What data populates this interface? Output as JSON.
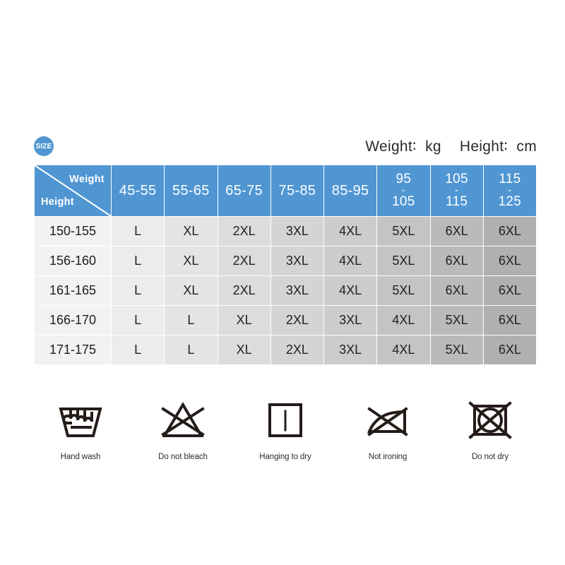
{
  "badge": {
    "label": "SIZE",
    "ghost_text": ""
  },
  "units": {
    "weight": "Weight∶  kg",
    "height": "Height∶  cm"
  },
  "table": {
    "corner": {
      "weight_label": "Weight",
      "height_label": "Height"
    },
    "weight_columns": [
      {
        "text": "45-55",
        "stacked": false
      },
      {
        "text": "55-65",
        "stacked": false
      },
      {
        "text": "65-75",
        "stacked": false
      },
      {
        "text": "75-85",
        "stacked": false
      },
      {
        "text": "85-95",
        "stacked": false
      },
      {
        "text": "95-105",
        "stacked": true,
        "top": "95",
        "dash": "-",
        "bottom": "105"
      },
      {
        "text": "105-115",
        "stacked": true,
        "top": "105",
        "dash": "-",
        "bottom": "115"
      },
      {
        "text": "115-125",
        "stacked": true,
        "top": "115",
        "dash": "-",
        "bottom": "125"
      }
    ],
    "rows": [
      {
        "height": "150-155",
        "sizes": [
          "L",
          "XL",
          "2XL",
          "3XL",
          "4XL",
          "5XL",
          "6XL",
          "6XL"
        ]
      },
      {
        "height": "156-160",
        "sizes": [
          "L",
          "XL",
          "2XL",
          "3XL",
          "4XL",
          "5XL",
          "6XL",
          "6XL"
        ]
      },
      {
        "height": "161-165",
        "sizes": [
          "L",
          "XL",
          "2XL",
          "3XL",
          "4XL",
          "5XL",
          "6XL",
          "6XL"
        ]
      },
      {
        "height": "166-170",
        "sizes": [
          "L",
          "L",
          "XL",
          "2XL",
          "3XL",
          "4XL",
          "5XL",
          "6XL"
        ]
      },
      {
        "height": "171-175",
        "sizes": [
          "L",
          "L",
          "XL",
          "2XL",
          "3XL",
          "4XL",
          "5XL",
          "6XL"
        ]
      }
    ]
  },
  "care_symbols": [
    {
      "icon": "hand-wash-icon",
      "label": "Hand wash"
    },
    {
      "icon": "do-not-bleach-icon",
      "label": "Do not bleach"
    },
    {
      "icon": "hang-to-dry-icon",
      "label": "Hanging to dry"
    },
    {
      "icon": "no-ironing-icon",
      "label": "Not ironing"
    },
    {
      "icon": "do-not-dry-icon",
      "label": "Do not dry"
    }
  ],
  "colors": {
    "header_blue": "#5096d2",
    "text_dark": "#222222",
    "icon_stroke": "#241c19",
    "gray_ramp": [
      "#f2f2f2",
      "#ececec",
      "#e4e4e4",
      "#dcdcdc",
      "#d4d4d4",
      "#cccccc",
      "#c4c4c4",
      "#bababa",
      "#b0b0b0"
    ]
  }
}
